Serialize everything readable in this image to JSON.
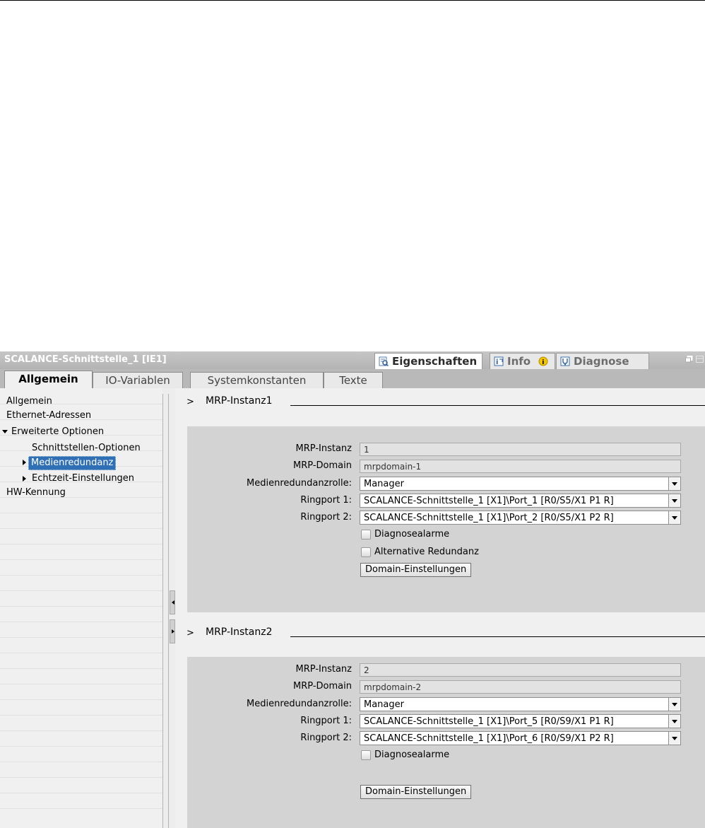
{
  "window": {
    "title": "SCALANCE-Schnittstelle_1 [IE1]",
    "panel_tabs": [
      {
        "label": "Eigenschaften",
        "icon": "properties-icon",
        "active": true
      },
      {
        "label": "Info",
        "icon": "info-icon",
        "badge_icon": "info-badge-icon",
        "active": false
      },
      {
        "label": "Diagnose",
        "icon": "diagnose-icon",
        "active": false
      }
    ]
  },
  "tabs": [
    {
      "label": "Allgemein",
      "active": true
    },
    {
      "label": "IO-Variablen",
      "active": false
    },
    {
      "label": "Systemkonstanten",
      "active": false
    },
    {
      "label": "Texte",
      "active": false
    }
  ],
  "nav": {
    "items": [
      {
        "label": "Allgemein"
      },
      {
        "label": "Ethernet-Adressen"
      },
      {
        "label": "Erweiterte Optionen",
        "expanded": true
      },
      {
        "label": "Schnittstellen-Optionen"
      },
      {
        "label": "Medienredundanz",
        "selected": true,
        "collapsed": true
      },
      {
        "label": "Echtzeit-Einstellungen",
        "collapsed": true
      },
      {
        "label": "HW-Kennung"
      }
    ]
  },
  "labels": {
    "mrp_instanz": "MRP-Instanz",
    "mrp_domain": "MRP-Domain",
    "rolle": "Medienredundanzrolle:",
    "ringport1": "Ringport 1:",
    "ringport2": "Ringport 2:"
  },
  "sections": [
    {
      "title": "MRP-Instanz1",
      "instanz": "1",
      "domain": "mrpdomain-1",
      "rolle": "Manager",
      "ringport1": "SCALANCE-Schnittstelle_1 [X1]\\Port_1 [R0/S5/X1 P1 R]",
      "ringport2": "SCALANCE-Schnittstelle_1 [X1]\\Port_2 [R0/S5/X1 P2 R]",
      "diagnosealarme": "Diagnosealarme",
      "alternative": "Alternative Redundanz",
      "domain_button": "Domain-Einstellungen"
    },
    {
      "title": "MRP-Instanz2",
      "instanz": "2",
      "domain": "mrpdomain-2",
      "rolle": "Manager",
      "ringport1": "SCALANCE-Schnittstelle_1 [X1]\\Port_5 [R0/S9/X1 P1 R]",
      "ringport2": "SCALANCE-Schnittstelle_1 [X1]\\Port_6 [R0/S9/X1 P2 R]",
      "diagnosealarme": "Diagnosealarme",
      "domain_button": "Domain-Einstellungen"
    }
  ]
}
